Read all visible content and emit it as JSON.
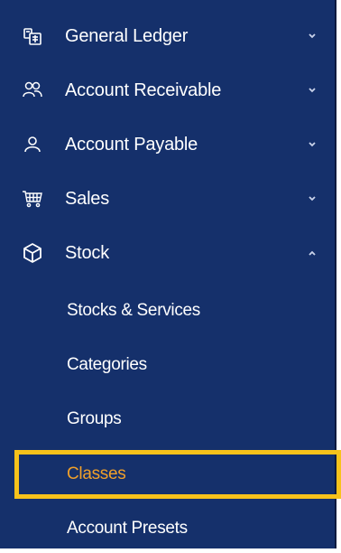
{
  "menu": {
    "items": [
      {
        "label": "General Ledger",
        "icon": "ledger-icon",
        "expanded": false
      },
      {
        "label": "Account Receivable",
        "icon": "users-icon",
        "expanded": false
      },
      {
        "label": "Account Payable",
        "icon": "user-icon",
        "expanded": false
      },
      {
        "label": "Sales",
        "icon": "cart-icon",
        "expanded": false
      },
      {
        "label": "Stock",
        "icon": "cube-icon",
        "expanded": true
      }
    ],
    "stock_subitems": [
      {
        "label": "Stocks & Services"
      },
      {
        "label": "Categories"
      },
      {
        "label": "Groups"
      },
      {
        "label": "Classes",
        "active": true
      },
      {
        "label": "Account Presets"
      }
    ]
  },
  "colors": {
    "sidebar_bg": "#15306b",
    "text": "#ffffff",
    "active_text": "#f0a02a",
    "highlight_border": "#f7c21b"
  }
}
